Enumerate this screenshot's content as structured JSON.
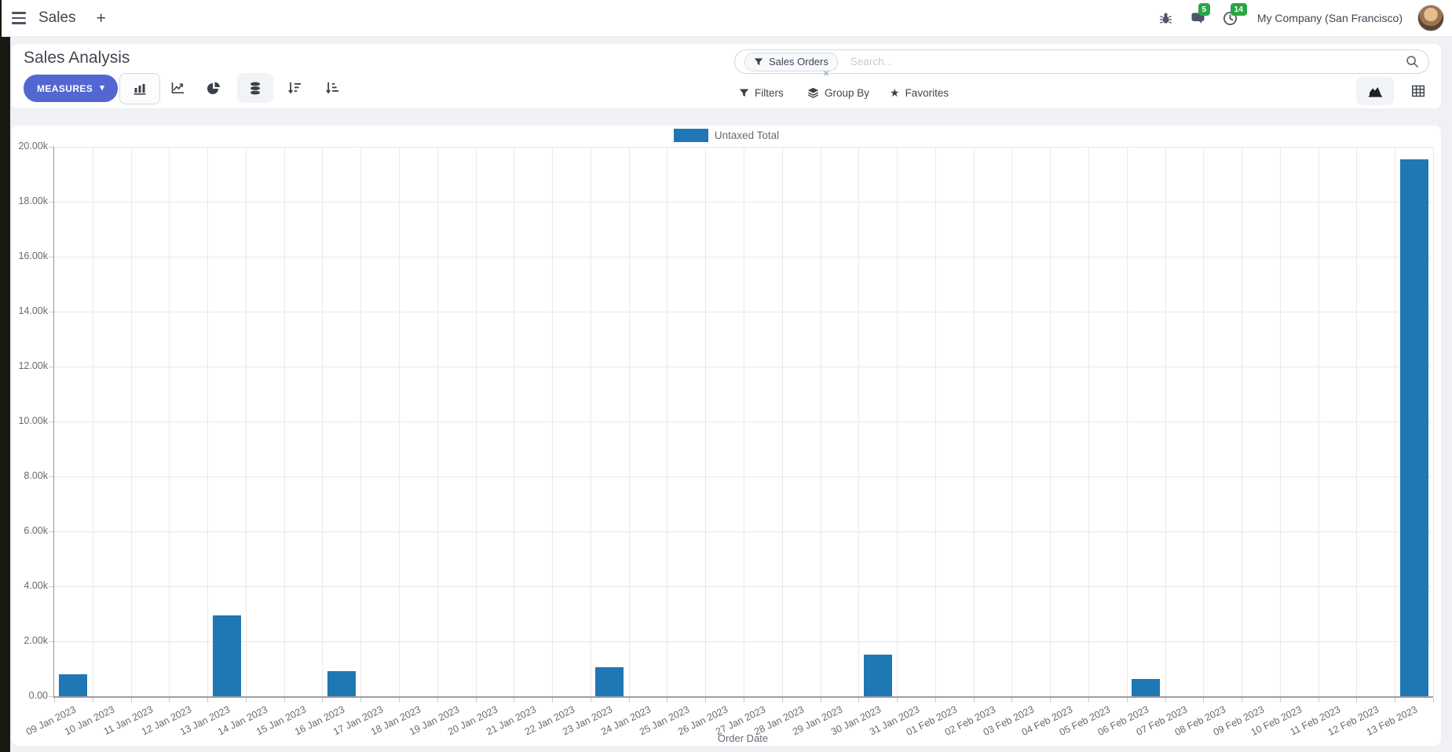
{
  "navbar": {
    "menu_label": "Sales",
    "messages_badge": "5",
    "activities_badge": "14",
    "company": "My Company (San Francisco)"
  },
  "control_panel": {
    "title": "Sales Analysis",
    "measures_label": "MEASURES",
    "filters_label": "Filters",
    "group_by_label": "Group By",
    "favorites_label": "Favorites",
    "search": {
      "facet": "Sales Orders",
      "placeholder": "Search..."
    }
  },
  "icons": {
    "plus": "+",
    "caret_down": "▾",
    "close": "×",
    "star": "★"
  },
  "colors": {
    "accent": "#5367d2",
    "bar_blue": "#1f77b4",
    "badge_green": "#28a745"
  },
  "chart_data": {
    "type": "bar",
    "title": "",
    "legend": [
      "Untaxed Total"
    ],
    "series_color": "#1f77b4",
    "xlabel": "Order Date",
    "ylabel": "",
    "ylim": [
      0,
      20000
    ],
    "grid": true,
    "legend_position": "top",
    "y_ticks": [
      "0.00",
      "2.00k",
      "4.00k",
      "6.00k",
      "8.00k",
      "10.00k",
      "12.00k",
      "14.00k",
      "16.00k",
      "18.00k",
      "20.00k"
    ],
    "categories": [
      "09 Jan 2023",
      "10 Jan 2023",
      "11 Jan 2023",
      "12 Jan 2023",
      "13 Jan 2023",
      "14 Jan 2023",
      "15 Jan 2023",
      "16 Jan 2023",
      "17 Jan 2023",
      "18 Jan 2023",
      "19 Jan 2023",
      "20 Jan 2023",
      "21 Jan 2023",
      "22 Jan 2023",
      "23 Jan 2023",
      "24 Jan 2023",
      "25 Jan 2023",
      "26 Jan 2023",
      "27 Jan 2023",
      "28 Jan 2023",
      "29 Jan 2023",
      "30 Jan 2023",
      "31 Jan 2023",
      "01 Feb 2023",
      "02 Feb 2023",
      "03 Feb 2023",
      "04 Feb 2023",
      "05 Feb 2023",
      "06 Feb 2023",
      "07 Feb 2023",
      "08 Feb 2023",
      "09 Feb 2023",
      "10 Feb 2023",
      "11 Feb 2023",
      "12 Feb 2023",
      "13 Feb 2023"
    ],
    "values": [
      800,
      0,
      0,
      0,
      2940,
      0,
      0,
      910,
      0,
      0,
      0,
      0,
      0,
      0,
      1060,
      0,
      0,
      0,
      0,
      0,
      0,
      1510,
      0,
      0,
      0,
      0,
      0,
      0,
      630,
      0,
      0,
      0,
      0,
      0,
      0,
      19540
    ]
  }
}
